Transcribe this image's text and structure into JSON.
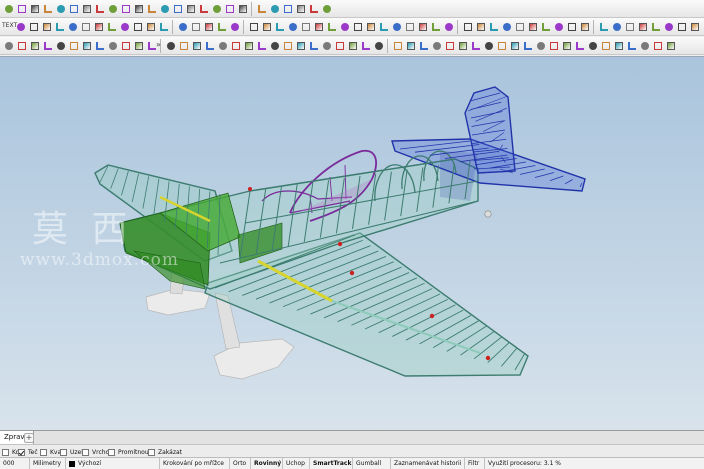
{
  "toolbar": {
    "row1_text": "",
    "row2_text": "TEXT",
    "overflow": "»"
  },
  "viewport": {
    "tab_label": "Zprava",
    "add_tab": "+",
    "watermark_cn": "莫 西",
    "watermark_url": "www.3dmox.com"
  },
  "osnap": [
    {
      "label": "Koi",
      "checked": false
    },
    {
      "label": "Teč",
      "checked": true
    },
    {
      "label": "Kva",
      "checked": false
    },
    {
      "label": "Uzel",
      "checked": false
    },
    {
      "label": "Vrchol",
      "checked": false
    },
    {
      "label": "Promítnout",
      "checked": false
    },
    {
      "label": "Zakázat",
      "checked": false
    }
  ],
  "status": {
    "coord": "000",
    "units": "Milimetry",
    "layer": "Výchozí",
    "grid_snap": "Krokování po mřížce",
    "ortho": "Orto",
    "planar": "Rovinný",
    "osnap": "Uchop",
    "smarttrack": "SmartTrack",
    "gumball": "Gumball",
    "history": "Zaznamenávat historii",
    "filter": "Filtr",
    "cpu": "Využití procesoru: 3.1 %"
  },
  "colors": {
    "frame": "#3d7c70",
    "tail": "#2233aa",
    "canopy": "#7a2a9a",
    "nose": "#2f8a22",
    "float": "#e6e6e6"
  }
}
